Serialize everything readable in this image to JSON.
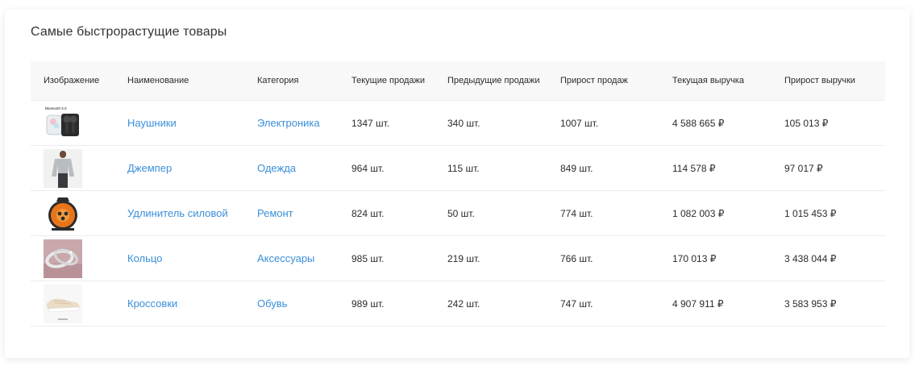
{
  "widget": {
    "title": "Самые быстрорастущие товары"
  },
  "columns": [
    "Изображение",
    "Наименование",
    "Категория",
    "Текущие продажи",
    "Предыдущие продажи",
    "Прирост продаж",
    "Текущая выручка",
    "Прирост выручки"
  ],
  "rows": [
    {
      "image": "earbuds-product-image",
      "image_caption": "Bluetooth 5.0",
      "name": "Наушники",
      "category": "Электроника",
      "current_sales": "1347 шт.",
      "previous_sales": "340 шт.",
      "sales_growth": "1007 шт.",
      "current_revenue": "4 588 665 ₽",
      "revenue_growth": "105 013 ₽"
    },
    {
      "image": "sweater-product-image",
      "name": "Джемпер",
      "category": "Одежда",
      "current_sales": "964  шт.",
      "previous_sales": "115 шт.",
      "sales_growth": "849 шт.",
      "current_revenue": "114 578 ₽",
      "revenue_growth": "97 017 ₽"
    },
    {
      "image": "cable-reel-product-image",
      "name": "Удлинитель силовой",
      "category": "Ремонт",
      "current_sales": "824 шт.",
      "previous_sales": "50 шт.",
      "sales_growth": "774 шт.",
      "current_revenue": "1 082 003 ₽",
      "revenue_growth": "1 015 453 ₽"
    },
    {
      "image": "rings-product-image",
      "name": "Кольцо",
      "category": "Аксессуары",
      "current_sales": "985 шт.",
      "previous_sales": "219 шт.",
      "sales_growth": "766 шт.",
      "current_revenue": "170 013 ₽",
      "revenue_growth": "3 438 044 ₽"
    },
    {
      "image": "sneakers-product-image",
      "name": "Кроссовки",
      "category": "Обувь",
      "current_sales": "989 шт.",
      "previous_sales": "242 шт.",
      "sales_growth": "747 шт.",
      "current_revenue": "4 907 911 ₽",
      "revenue_growth": "3 583 953 ₽"
    }
  ],
  "colors": {
    "link": "#3b8fd9",
    "header_bg": "#f8f8f9",
    "divider": "#ececf1"
  }
}
